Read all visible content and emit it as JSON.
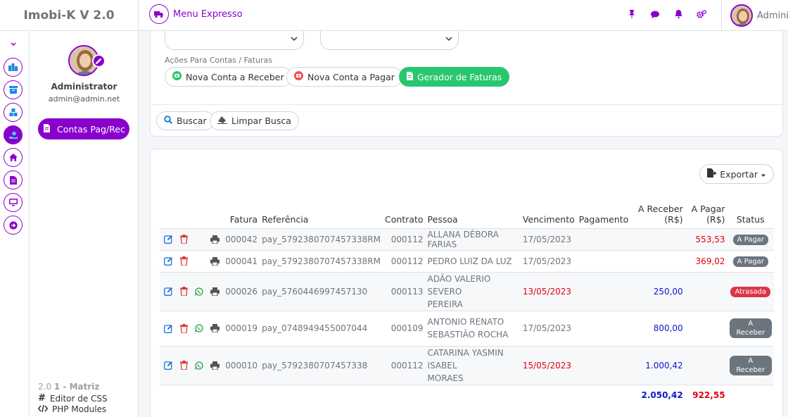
{
  "app": {
    "brand": "Imobi-K V 2.0"
  },
  "topbar": {
    "menu_expresso": "Menu Expresso",
    "user_name": "Administrator",
    "icons": [
      "pin-icon",
      "chat-icon",
      "bell-icon",
      "cogs-icon"
    ]
  },
  "sidebar": {
    "name": "Administrator",
    "email": "admin@admin.net",
    "active_item": "Contas Pag/Rec",
    "version": "2.0",
    "unit": "1 - Matriz",
    "links": [
      "Editor de CSS",
      "PHP Modules"
    ]
  },
  "filters": {
    "actions_label": "Ações Para Contas / Faturas",
    "btn_receber": "Nova Conta a Receber",
    "btn_pagar": "Nova Conta a Pagar",
    "btn_gerador": "Gerador de Faturas",
    "btn_buscar": "Buscar",
    "btn_limpar": "Limpar Busca"
  },
  "table": {
    "export_label": "Exportar",
    "headers": {
      "fatura": "Fatura",
      "referencia": "Referência",
      "contrato": "Contrato",
      "pessoa": "Pessoa",
      "vencimento": "Vencimento",
      "pagamento": "Pagamento",
      "a_receber_1": "A Receber",
      "a_receber_2": "(R$)",
      "a_pagar_1": "A Pagar",
      "a_pagar_2": "(R$)",
      "status": "Status"
    },
    "rows": [
      {
        "fatura": "000042",
        "referencia": "pay_5792380707457338RM",
        "contrato": "000112",
        "pessoa": "ALLANA DÉBORA FARIAS",
        "vencimento": "17/05/2023",
        "pagamento": "",
        "a_receber": "",
        "a_pagar": "553,53",
        "status": "A Pagar"
      },
      {
        "fatura": "000041",
        "referencia": "pay_5792380707457338RM",
        "contrato": "000112",
        "pessoa": "PEDRO LUIZ DA LUZ",
        "vencimento": "17/05/2023",
        "pagamento": "",
        "a_receber": "",
        "a_pagar": "369,02",
        "status": "A Pagar"
      },
      {
        "fatura": "000026",
        "referencia": "pay_5760446997457130",
        "contrato": "000113",
        "pessoa_1": "ADÃO VALERIO SEVERO",
        "pessoa_2": "PEREIRA",
        "vencimento": "13/05/2023",
        "pagamento": "",
        "a_receber": "250,00",
        "a_pagar": "",
        "status": "Atrasada"
      },
      {
        "fatura": "000019",
        "referencia": "pay_0748949455007044",
        "contrato": "000109",
        "pessoa_1": "ANTONIO RENATO",
        "pessoa_2": "SEBASTIÃO ROCHA",
        "vencimento": "17/05/2023",
        "pagamento": "",
        "a_receber": "800,00",
        "a_pagar": "",
        "status": "A Receber"
      },
      {
        "fatura": "000010",
        "referencia": "pay_5792380707457338",
        "contrato": "000112",
        "pessoa_1": "CATARINA YASMIN ISABEL",
        "pessoa_2": "MORAES",
        "vencimento": "15/05/2023",
        "pagamento": "",
        "a_receber": "1.000,42",
        "a_pagar": "",
        "status": "A Receber"
      }
    ],
    "totals": {
      "a_receber": "2.050,42",
      "a_pagar": "922,55"
    }
  },
  "colors": {
    "accent": "#8800cc",
    "green": "#28c76f",
    "late_red": "#e3000f",
    "receive_blue": "#0b18c8"
  }
}
